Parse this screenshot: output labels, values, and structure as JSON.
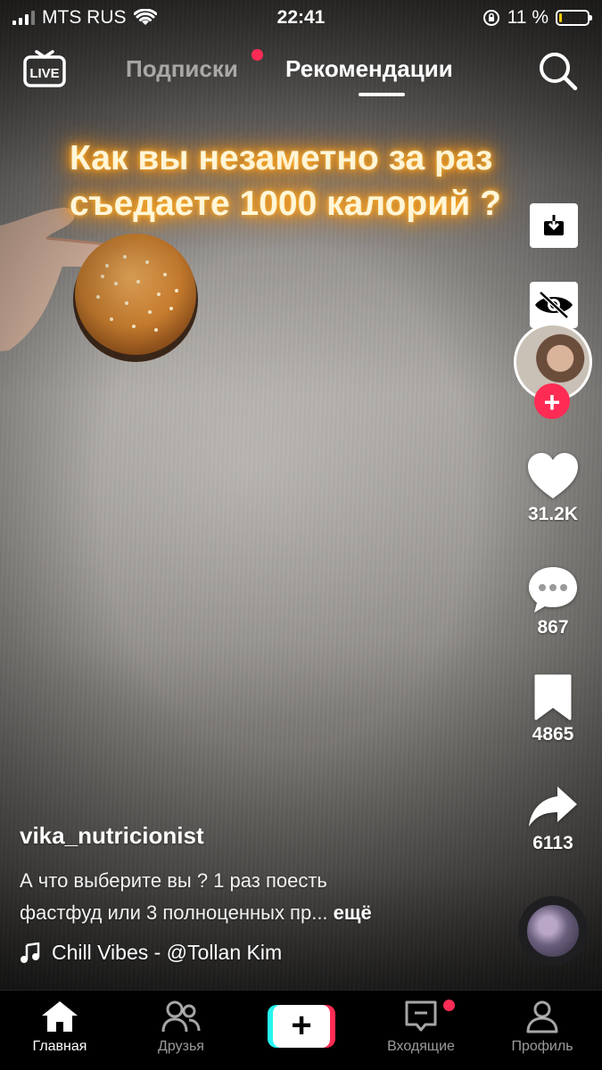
{
  "status_bar": {
    "carrier": "MTS RUS",
    "time": "22:41",
    "battery_text": "11 %",
    "battery_level": 0.11
  },
  "top_nav": {
    "live_label": "LIVE",
    "tabs": [
      {
        "label": "Подписки",
        "active": false,
        "has_dot": true
      },
      {
        "label": "Рекомендации",
        "active": true
      }
    ],
    "search_icon": "search-icon"
  },
  "video": {
    "overlay_lines": [
      "Как вы незаметно за раз",
      "съедаете 1000 калорий ?"
    ]
  },
  "rail": {
    "like_count": "31.2K",
    "comment_count": "867",
    "save_count": "4865",
    "share_count": "6113",
    "follow_symbol": "+"
  },
  "post": {
    "author": "vika_nutricionist",
    "description_line1": "А что выберите вы ?  1 раз поесть",
    "description_line2": "фастфуд или 3 полноценных пр...",
    "more_label": "ещё",
    "sound": "Chill Vibes - @Tollan Kim"
  },
  "tab_bar": {
    "items": [
      {
        "label": "Главная",
        "icon": "home-icon",
        "active": true
      },
      {
        "label": "Друзья",
        "icon": "friends-icon"
      },
      {
        "label": "Входящие",
        "icon": "inbox-icon",
        "has_dot": true
      },
      {
        "label": "Профиль",
        "icon": "profile-icon"
      }
    ],
    "create_symbol": "+"
  },
  "colors": {
    "accent_red": "#fe2c55",
    "accent_cyan": "#25f4ee",
    "overlay_glow": "#ff9a1a",
    "battery_yellow": "#ffcc00"
  }
}
